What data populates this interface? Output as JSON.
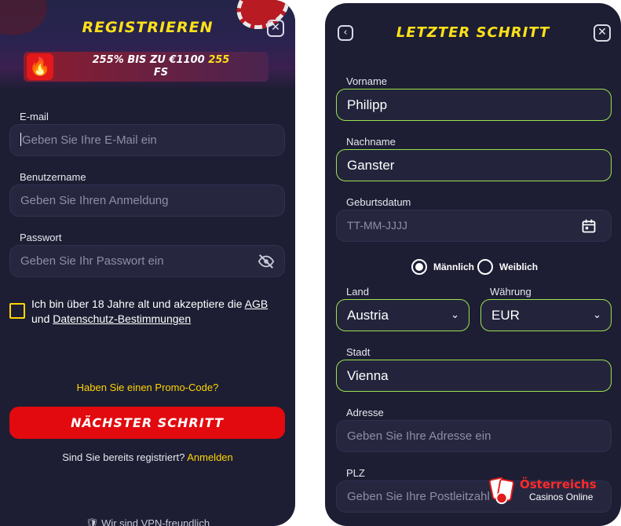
{
  "registration": {
    "title": "REGISTRIEREN",
    "close_icon": "close-icon",
    "promo": {
      "icon": "fire-icon",
      "text_part1": "255% BIS ZU €1100 ",
      "text_highlight": "255",
      "text_part2": "FS"
    },
    "email": {
      "label": "E-mail",
      "placeholder": "Geben Sie Ihre E-Mail ein"
    },
    "username": {
      "label": "Benutzername",
      "placeholder": "Geben Sie Ihren Anmeldung"
    },
    "password": {
      "label": "Passwort",
      "placeholder": "Geben Sie Ihr Passwort ein",
      "toggle_icon": "eye-off-icon"
    },
    "consent": {
      "text_before": "Ich bin über 18 Jahre alt und akzeptiere die ",
      "terms_link": "AGB",
      "text_and": " und ",
      "privacy_link": "Datenschutz-Bestimmungen",
      "checked": false
    },
    "promo_code_link": "Haben Sie einen Promo-Code?",
    "next_button": "NÄCHSTER SCHRITT",
    "already_registered": "Sind Sie bereits registriert?",
    "login_link": "Anmelden",
    "vpn_note": "Wir sind VPN-freundlich",
    "colors": {
      "accent_yellow": "#ffe11a",
      "primary_red": "#e20a0e",
      "panel_bg": "#1d1e33"
    }
  },
  "final_step": {
    "title": "LETZTER SCHRITT",
    "back_icon": "chevron-left-icon",
    "close_icon": "close-icon",
    "first_name": {
      "label": "Vorname",
      "value": "Philipp"
    },
    "last_name": {
      "label": "Nachname",
      "value": "Ganster"
    },
    "birthdate": {
      "label": "Geburtsdatum",
      "placeholder": "TT-MM-JJJJ",
      "icon": "calendar-icon"
    },
    "gender": {
      "options": [
        {
          "label": "Männlich",
          "selected": true
        },
        {
          "label": "Weiblich",
          "selected": false
        }
      ]
    },
    "country": {
      "label": "Land",
      "value": "Austria"
    },
    "currency": {
      "label": "Währung",
      "value": "EUR"
    },
    "city": {
      "label": "Stadt",
      "value": "Vienna"
    },
    "address": {
      "label": "Adresse",
      "placeholder": "Geben Sie Ihre Adresse ein"
    },
    "zip": {
      "label": "PLZ",
      "placeholder": "Geben Sie Ihre Postleitzahl"
    },
    "colors": {
      "valid_border": "#9be24f"
    }
  },
  "watermark": {
    "title": "Österreichs",
    "subtitle": "Casinos Online"
  }
}
